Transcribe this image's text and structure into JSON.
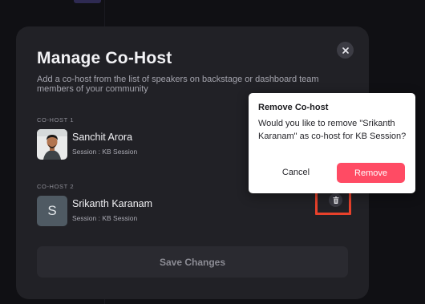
{
  "modal": {
    "title": "Manage Co-Host",
    "description": "Add a co-host from the list of speakers on backstage or dashboard team members of your community",
    "close_icon": "close-icon",
    "save_label": "Save Changes"
  },
  "cohosts": [
    {
      "label": "CO-HOST 1",
      "name": "Sanchit Arora",
      "session": "Session : KB Session",
      "avatar": "photo"
    },
    {
      "label": "CO-HOST 2",
      "name": "Srikanth Karanam",
      "session": "Session : KB Session",
      "avatar_letter": "S"
    }
  ],
  "popover": {
    "title": "Remove Co-host",
    "body": "Would you like to remove \"Srikanth Karanam\" as co-host for KB Session?",
    "cancel_label": "Cancel",
    "remove_label": "Remove"
  },
  "colors": {
    "modal_bg": "#212126",
    "remove_accent": "#ff4b64",
    "highlight": "#e8412b"
  },
  "icons": [
    "close-icon",
    "trash-icon",
    "user-avatar"
  ]
}
